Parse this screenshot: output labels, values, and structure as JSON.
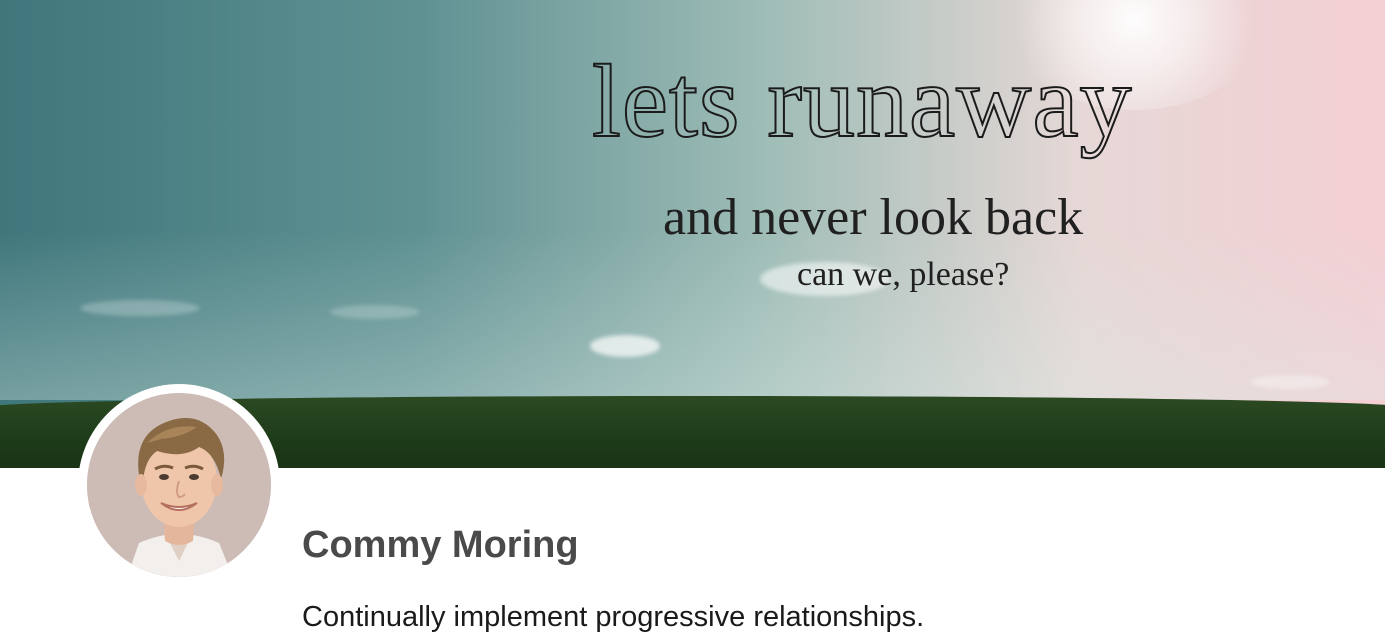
{
  "cover": {
    "line1": "lets runaway",
    "line2": "and never look back",
    "line3": "can we, please?"
  },
  "profile": {
    "name": "Commy Moring",
    "bio": "Continually implement progressive relationships."
  },
  "colors": {
    "name_text": "#4a4a4a",
    "bio_text": "#1a1a1a",
    "field_green": "#1d3a18"
  }
}
